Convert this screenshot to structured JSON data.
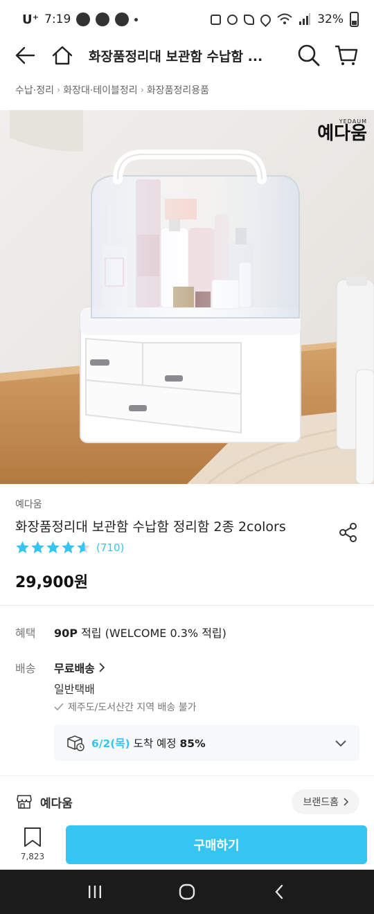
{
  "status_bar": {
    "carrier": "U⁺",
    "time": "7:19",
    "battery": "32%"
  },
  "header": {
    "title": "화장품정리대 보관함 수납함 ..."
  },
  "breadcrumb": [
    "수납·정리",
    "화장대·테이블정리",
    "화장품정리용품"
  ],
  "hero": {
    "logo_small": "YEDAUM",
    "logo_main": "예다움"
  },
  "product": {
    "brand": "예다움",
    "title": "화장품정리대 보관함 수납함 정리함 2종 2colors",
    "rating": 4.6,
    "review_count": "(710)",
    "price": "29,900원"
  },
  "benefit": {
    "label": "혜택",
    "points": "90P",
    "text": " 적립 (WELCOME 0.3% 적립)"
  },
  "shipping": {
    "label": "배송",
    "title": "무료배송",
    "type": "일반택배",
    "note": "제주도/도서산간 지역 배송 불가",
    "eta_date": "6/2(목)",
    "eta_text": " 도착 예정 ",
    "eta_pct": "85%"
  },
  "store": {
    "name": "예다움",
    "brand_home_label": "브랜드홈"
  },
  "bottom_bar": {
    "bookmark_count": "7,823",
    "buy_label": "구매하기"
  },
  "colors": {
    "accent": "#35c5f0",
    "text": "#222222",
    "muted": "#777777"
  }
}
